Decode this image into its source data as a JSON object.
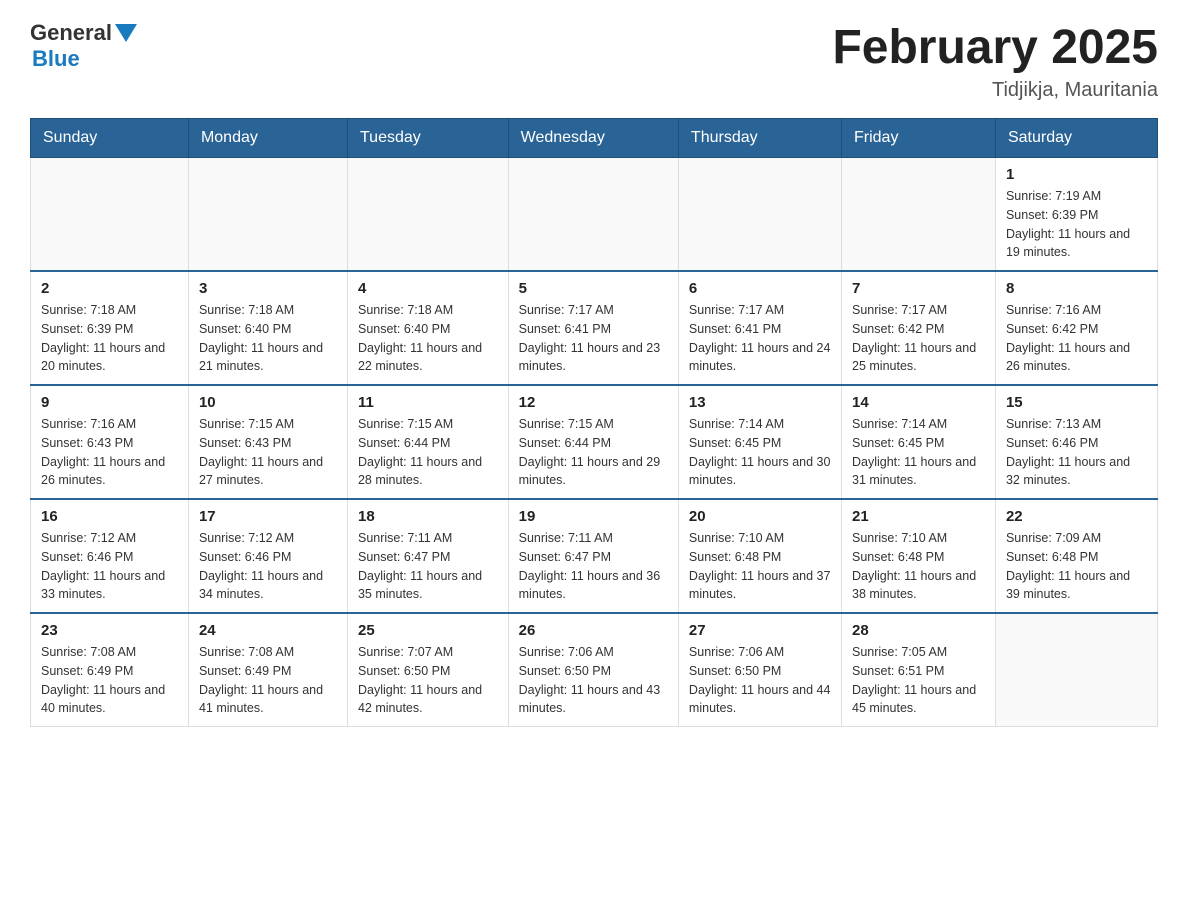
{
  "header": {
    "logo_general": "General",
    "logo_blue": "Blue",
    "title": "February 2025",
    "subtitle": "Tidjikja, Mauritania"
  },
  "days_of_week": [
    "Sunday",
    "Monday",
    "Tuesday",
    "Wednesday",
    "Thursday",
    "Friday",
    "Saturday"
  ],
  "weeks": [
    [
      {
        "day": "",
        "info": ""
      },
      {
        "day": "",
        "info": ""
      },
      {
        "day": "",
        "info": ""
      },
      {
        "day": "",
        "info": ""
      },
      {
        "day": "",
        "info": ""
      },
      {
        "day": "",
        "info": ""
      },
      {
        "day": "1",
        "info": "Sunrise: 7:19 AM\nSunset: 6:39 PM\nDaylight: 11 hours and 19 minutes."
      }
    ],
    [
      {
        "day": "2",
        "info": "Sunrise: 7:18 AM\nSunset: 6:39 PM\nDaylight: 11 hours and 20 minutes."
      },
      {
        "day": "3",
        "info": "Sunrise: 7:18 AM\nSunset: 6:40 PM\nDaylight: 11 hours and 21 minutes."
      },
      {
        "day": "4",
        "info": "Sunrise: 7:18 AM\nSunset: 6:40 PM\nDaylight: 11 hours and 22 minutes."
      },
      {
        "day": "5",
        "info": "Sunrise: 7:17 AM\nSunset: 6:41 PM\nDaylight: 11 hours and 23 minutes."
      },
      {
        "day": "6",
        "info": "Sunrise: 7:17 AM\nSunset: 6:41 PM\nDaylight: 11 hours and 24 minutes."
      },
      {
        "day": "7",
        "info": "Sunrise: 7:17 AM\nSunset: 6:42 PM\nDaylight: 11 hours and 25 minutes."
      },
      {
        "day": "8",
        "info": "Sunrise: 7:16 AM\nSunset: 6:42 PM\nDaylight: 11 hours and 26 minutes."
      }
    ],
    [
      {
        "day": "9",
        "info": "Sunrise: 7:16 AM\nSunset: 6:43 PM\nDaylight: 11 hours and 26 minutes."
      },
      {
        "day": "10",
        "info": "Sunrise: 7:15 AM\nSunset: 6:43 PM\nDaylight: 11 hours and 27 minutes."
      },
      {
        "day": "11",
        "info": "Sunrise: 7:15 AM\nSunset: 6:44 PM\nDaylight: 11 hours and 28 minutes."
      },
      {
        "day": "12",
        "info": "Sunrise: 7:15 AM\nSunset: 6:44 PM\nDaylight: 11 hours and 29 minutes."
      },
      {
        "day": "13",
        "info": "Sunrise: 7:14 AM\nSunset: 6:45 PM\nDaylight: 11 hours and 30 minutes."
      },
      {
        "day": "14",
        "info": "Sunrise: 7:14 AM\nSunset: 6:45 PM\nDaylight: 11 hours and 31 minutes."
      },
      {
        "day": "15",
        "info": "Sunrise: 7:13 AM\nSunset: 6:46 PM\nDaylight: 11 hours and 32 minutes."
      }
    ],
    [
      {
        "day": "16",
        "info": "Sunrise: 7:12 AM\nSunset: 6:46 PM\nDaylight: 11 hours and 33 minutes."
      },
      {
        "day": "17",
        "info": "Sunrise: 7:12 AM\nSunset: 6:46 PM\nDaylight: 11 hours and 34 minutes."
      },
      {
        "day": "18",
        "info": "Sunrise: 7:11 AM\nSunset: 6:47 PM\nDaylight: 11 hours and 35 minutes."
      },
      {
        "day": "19",
        "info": "Sunrise: 7:11 AM\nSunset: 6:47 PM\nDaylight: 11 hours and 36 minutes."
      },
      {
        "day": "20",
        "info": "Sunrise: 7:10 AM\nSunset: 6:48 PM\nDaylight: 11 hours and 37 minutes."
      },
      {
        "day": "21",
        "info": "Sunrise: 7:10 AM\nSunset: 6:48 PM\nDaylight: 11 hours and 38 minutes."
      },
      {
        "day": "22",
        "info": "Sunrise: 7:09 AM\nSunset: 6:48 PM\nDaylight: 11 hours and 39 minutes."
      }
    ],
    [
      {
        "day": "23",
        "info": "Sunrise: 7:08 AM\nSunset: 6:49 PM\nDaylight: 11 hours and 40 minutes."
      },
      {
        "day": "24",
        "info": "Sunrise: 7:08 AM\nSunset: 6:49 PM\nDaylight: 11 hours and 41 minutes."
      },
      {
        "day": "25",
        "info": "Sunrise: 7:07 AM\nSunset: 6:50 PM\nDaylight: 11 hours and 42 minutes."
      },
      {
        "day": "26",
        "info": "Sunrise: 7:06 AM\nSunset: 6:50 PM\nDaylight: 11 hours and 43 minutes."
      },
      {
        "day": "27",
        "info": "Sunrise: 7:06 AM\nSunset: 6:50 PM\nDaylight: 11 hours and 44 minutes."
      },
      {
        "day": "28",
        "info": "Sunrise: 7:05 AM\nSunset: 6:51 PM\nDaylight: 11 hours and 45 minutes."
      },
      {
        "day": "",
        "info": ""
      }
    ]
  ]
}
